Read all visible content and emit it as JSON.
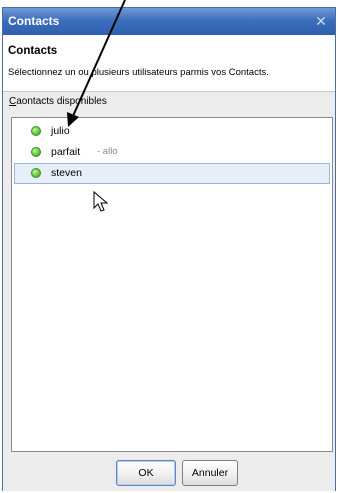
{
  "window": {
    "title": "Contacts",
    "close_glyph": "✕"
  },
  "header": {
    "title": "Contacts",
    "description": "Sélectionnez un ou plusieurs utilisateurs parmis vos Contacts."
  },
  "list": {
    "label_prefix": "C",
    "label_rest": "aontacts disponibles",
    "contacts": [
      {
        "name": "julio",
        "status": "",
        "presence": "online",
        "selected": false
      },
      {
        "name": "parfait",
        "status": "- allo",
        "presence": "online",
        "selected": false
      },
      {
        "name": "steven",
        "status": "",
        "presence": "online",
        "selected": true
      }
    ]
  },
  "buttons": {
    "ok": "OK",
    "cancel": "Annuler"
  },
  "icons": {
    "presence": "online-status-icon",
    "annotation": "annotation-arrow-icon",
    "cursor": "mouse-pointer-icon"
  },
  "colors": {
    "titlebar": "#3d6fbd",
    "presence_online": "#6fd34a",
    "selection": "#e7eef8"
  }
}
